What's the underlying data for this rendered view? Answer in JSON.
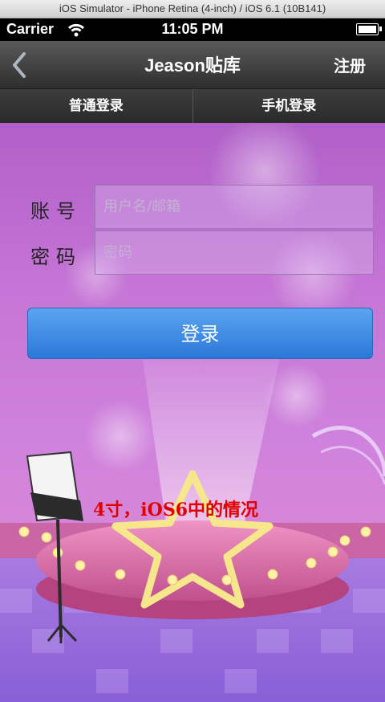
{
  "simulator_title": "iOS Simulator - iPhone Retina (4-inch) / iOS 6.1 (10B141)",
  "status_bar": {
    "carrier": "Carrier",
    "time": "11:05 PM"
  },
  "nav": {
    "back_icon": "chevron-left-icon",
    "title": "Jeason贴库",
    "register_label": "注册"
  },
  "tabs": [
    {
      "label": "普通登录"
    },
    {
      "label": "手机登录"
    }
  ],
  "form": {
    "account_label": "账号",
    "account_placeholder": "用户名/邮箱",
    "password_label": "密码",
    "password_placeholder": "密码",
    "login_label": "登录"
  },
  "caption": "4寸，iOS6中的情况",
  "colors": {
    "login_button": "#3b8de6",
    "caption": "#e00000",
    "nav_bar": "#3a3a3a"
  }
}
